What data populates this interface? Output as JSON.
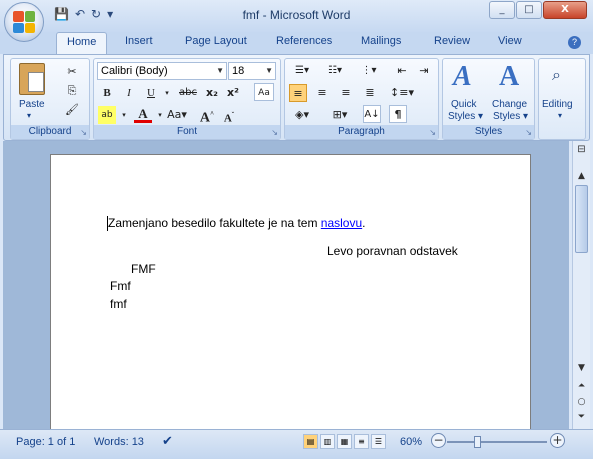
{
  "window": {
    "title": "fmf - Microsoft Word"
  },
  "window_controls": {
    "minimize": "_",
    "maximize": "□",
    "close": "X"
  },
  "qat": {
    "save": "💾",
    "undo": "↶",
    "redo": "↻",
    "more": "▾"
  },
  "tabs": [
    "Home",
    "Insert",
    "Page Layout",
    "References",
    "Mailings",
    "Review",
    "View"
  ],
  "help": "?",
  "clipboard": {
    "paste": "Paste",
    "label": "Clipboard"
  },
  "font": {
    "name": "Calibri (Body)",
    "size": "18",
    "label": "Font",
    "grow": "A",
    "shrink": "A"
  },
  "paragraph": {
    "label": "Paragraph"
  },
  "styles": {
    "quick": "Quick",
    "quick2": "Styles",
    "change": "Change",
    "change2": "Styles",
    "label": "Styles"
  },
  "editing": {
    "label": "Editing"
  },
  "document": {
    "line1_text": "Zamenjano besedilo fakultete je na tem ",
    "line1_link": "naslovu",
    "line1_end": ".",
    "line2": "Levo poravnan odstavek",
    "line3": "FMF",
    "line4": "Fmf",
    "line5": "fmf"
  },
  "status": {
    "page": "Page: 1 of 1",
    "words": "Words: 13",
    "zoom": "60%",
    "zoom_level": 0.6
  }
}
